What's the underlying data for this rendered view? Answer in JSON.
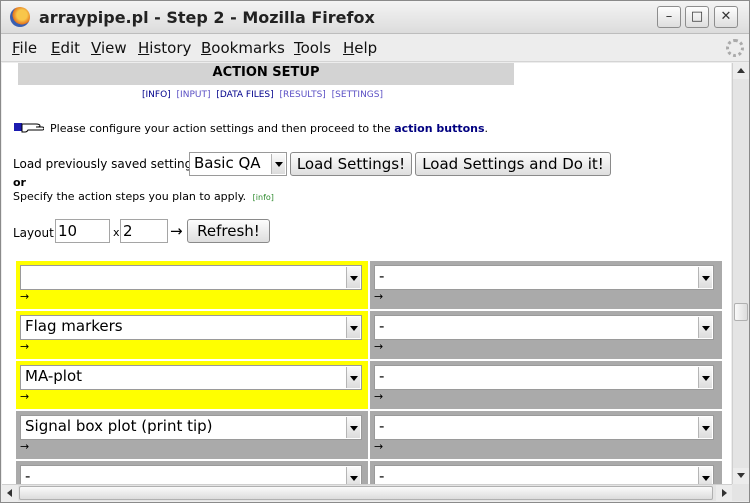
{
  "window": {
    "title": "arraypipe.pl - Step 2 - Mozilla Firefox",
    "minimize": "–",
    "maximize": "□",
    "close": "✕"
  },
  "menu": [
    "File",
    "Edit",
    "View",
    "History",
    "Bookmarks",
    "Tools",
    "Help"
  ],
  "page": {
    "header": "ACTION SETUP",
    "tabs": [
      "[INFO]",
      "[INPUT]",
      "[DATA FILES]",
      "[RESULTS]",
      "[SETTINGS]"
    ],
    "instruction_prefix": "Please configure your action settings and then proceed to the",
    "instruction_bold": "action buttons",
    "instruction_suffix": ".",
    "load_label": "Load previously saved settings:",
    "saved_settings_value": "Basic QA",
    "load_button": "Load Settings!",
    "load_do_button": "Load Settings and Do it!",
    "or_label": "or",
    "specify_label": "Specify the action steps you plan to apply.",
    "info_link": "[info]",
    "layout_label": "Layout:",
    "layout_rows": "10",
    "layout_x": "x",
    "layout_cols": "2",
    "layout_arrow": "→",
    "refresh_button": "Refresh!"
  },
  "steps": [
    {
      "left": "",
      "right": "-",
      "arrow_left": "→",
      "arrow_right": "→"
    },
    {
      "left": "Flag markers",
      "right": "-",
      "arrow_left": "→",
      "arrow_right": "→"
    },
    {
      "left": "MA-plot",
      "right": "-",
      "arrow_left": "→",
      "arrow_right": "→"
    },
    {
      "left": "Signal box plot (print tip)",
      "right": "-",
      "arrow_left": "→",
      "arrow_right": "→"
    },
    {
      "left": "-",
      "right": "-",
      "arrow_left": "",
      "arrow_right": ""
    }
  ],
  "colors": {
    "active_cell": "#ffff00",
    "inactive_cell": "#aaaaaa",
    "header_bg": "#d3d3d3",
    "link": "#5a4fc4"
  }
}
